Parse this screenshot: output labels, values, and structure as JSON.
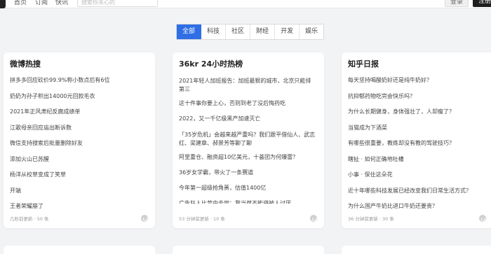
{
  "nav": {
    "items": [
      "首页",
      "订阅",
      "快讯"
    ],
    "search_placeholder": "搜索你关心的",
    "login_label": "登录",
    "signup_label": "注册"
  },
  "tabs": [
    {
      "label": "全部",
      "active": true
    },
    {
      "label": "科技",
      "active": false
    },
    {
      "label": "社区",
      "active": false
    },
    {
      "label": "财经",
      "active": false
    },
    {
      "label": "开发",
      "active": false
    },
    {
      "label": "娱乐",
      "active": false
    }
  ],
  "cards": [
    {
      "title": "微博热搜",
      "items": [
        "拼多多回应砍价99.9%称小数点后有6位",
        "奶奶为孙子积出14000元回款毛衣",
        "2021年正风肃纪反腐成绩单",
        "江歌母亲回应庙出断诉数",
        "微信支持搜索后批量删除好友",
        "添加火山已苏醒",
        "杨洋从校草变成了笑草",
        "开端",
        "王者荣耀崩了"
      ],
      "footer": "几秒前更新 · 50 条"
    },
    {
      "title": "36kr 24小时热榜",
      "items": [
        "2021年轻人加班报告：加班最狠的城市，北京只能排第三",
        "这十件事你要上心，否则到老了没后悔药吃",
        "2022，又一千亿级黑产加速灭亡",
        "「35岁危机」会越来越严重吗？我们跟平借仙人、武志红、梁建章、郝景芳等聊了聊",
        "阿里重仓、融资超10亿美元，十荟团为何爆雷？",
        "36岁女学霸，带火了一条赛道",
        "今年第一超级抢角蒉，估值1400亿",
        "广告狂人比苹中去世：我当然不能避被人讨厌"
      ],
      "footer": "53 分钟前更新 · 10 条"
    },
    {
      "title": "知乎日报",
      "items": [
        "每天坚持喝酸奶好还是纯牛奶好？",
        "抗抑郁药物吃完会快乐吗？",
        "为什么长期健身，身体强壮了，人却瘦了？",
        "当猫成为下酒菜",
        "有哪些很重要，教练却没有教的驾驶技巧？",
        "瞎扯 · 如何正确地吐槽",
        "小事 · 保住这朵花",
        "近十年哪些科技发展已经改变我们日常生活方式？",
        "为什么国产牛奶比进口牛奶还要贵？"
      ],
      "footer": "36 分钟前更新 · 30 条"
    }
  ]
}
